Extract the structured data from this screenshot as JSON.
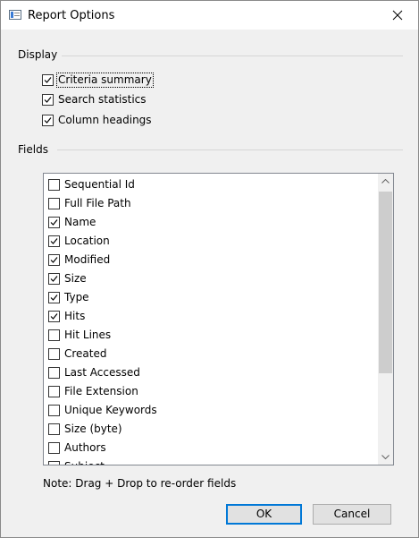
{
  "window": {
    "title": "Report Options",
    "icon": "report-window-icon",
    "close_icon": "close-icon"
  },
  "display": {
    "label": "Display",
    "options": [
      {
        "label": "Criteria summary",
        "checked": true,
        "focused": true
      },
      {
        "label": "Search statistics",
        "checked": true
      },
      {
        "label": "Column headings",
        "checked": true
      }
    ]
  },
  "fields": {
    "label": "Fields",
    "items": [
      {
        "label": "Sequential Id",
        "checked": false
      },
      {
        "label": "Full File Path",
        "checked": false
      },
      {
        "label": "Name",
        "checked": true
      },
      {
        "label": "Location",
        "checked": true
      },
      {
        "label": "Modified",
        "checked": true
      },
      {
        "label": "Size",
        "checked": true
      },
      {
        "label": "Type",
        "checked": true
      },
      {
        "label": "Hits",
        "checked": true
      },
      {
        "label": "Hit Lines",
        "checked": false
      },
      {
        "label": "Created",
        "checked": false
      },
      {
        "label": "Last Accessed",
        "checked": false
      },
      {
        "label": "File Extension",
        "checked": false
      },
      {
        "label": "Unique Keywords",
        "checked": false
      },
      {
        "label": "Size (byte)",
        "checked": false
      },
      {
        "label": "Authors",
        "checked": false
      },
      {
        "label": "Subject",
        "checked": false
      }
    ]
  },
  "note": "Note: Drag + Drop to re-order fields",
  "buttons": {
    "ok": "OK",
    "cancel": "Cancel"
  }
}
